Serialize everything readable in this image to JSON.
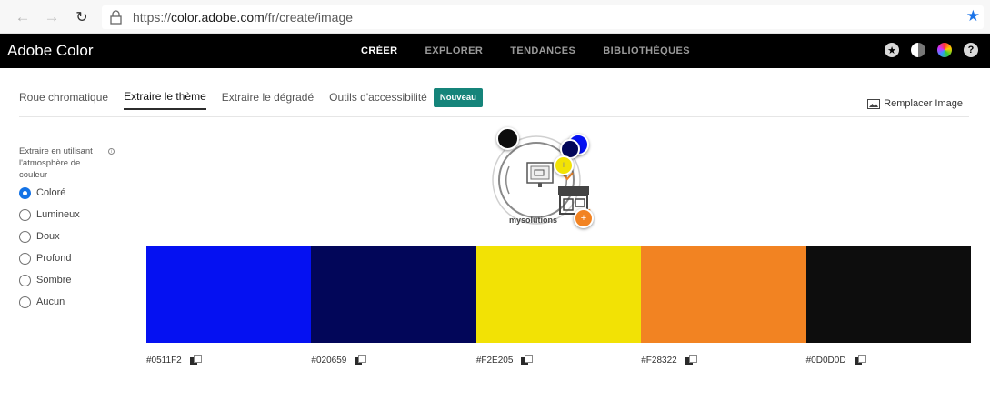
{
  "browser": {
    "url_prefix": "https://",
    "url_domain": "color.adobe.com",
    "url_path": "/fr/create/image",
    "icons": [
      "back-icon",
      "forward-icon",
      "reload-icon",
      "lock-icon",
      "star-icon"
    ]
  },
  "header": {
    "brand": "Adobe Color",
    "nav": [
      "CRÉER",
      "EXPLORER",
      "TENDANCES",
      "BIBLIOTHÈQUES"
    ],
    "active_nav": "CRÉER",
    "icons": [
      "profile-icon",
      "theme-toggle-icon",
      "color-wheel-icon",
      "help-icon"
    ]
  },
  "tabs": {
    "items": [
      "Roue chromatique",
      "Extraire le thème",
      "Extraire le dégradé",
      "Outils d'accessibilité"
    ],
    "active": "Extraire le thème",
    "badge": "Nouveau",
    "replace_image": "Remplacer Image"
  },
  "sidebar": {
    "extract_label": "Extraire en utilisant l'atmosphère de couleur",
    "moods": [
      "Coloré",
      "Lumineux",
      "Doux",
      "Profond",
      "Sombre",
      "Aucun"
    ],
    "selected_mood": "Coloré"
  },
  "image": {
    "logo_text": "mysolutions"
  },
  "palette": {
    "swatches": [
      {
        "hex": "#0511F2",
        "color": "#0511F2"
      },
      {
        "hex": "#020659",
        "color": "#020659"
      },
      {
        "hex": "#F2E205",
        "color": "#F2E205"
      },
      {
        "hex": "#F28322",
        "color": "#F28322"
      },
      {
        "hex": "#0D0D0D",
        "color": "#0D0D0D"
      }
    ]
  },
  "colors": {
    "accent": "#1473E6",
    "badge": "#15847A",
    "header_bg": "#000000"
  }
}
